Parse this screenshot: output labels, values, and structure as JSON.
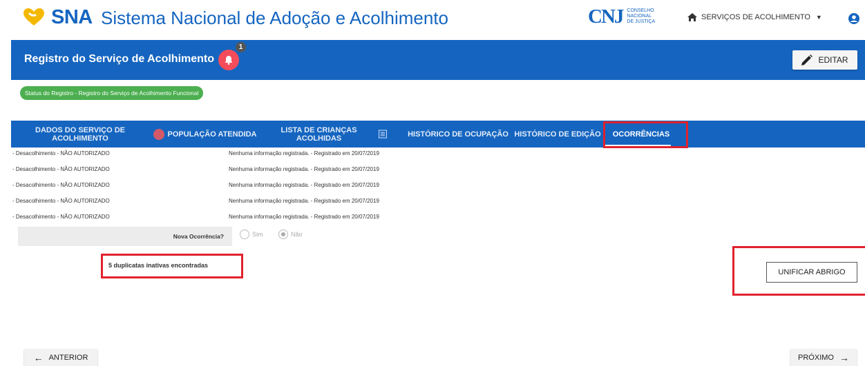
{
  "topbar": {
    "brand": "SNA",
    "app_title": "Sistema Nacional de Adoção e Acolhimento",
    "cnj_logo": "CNJ",
    "cnj_text_1": "CONSELHO",
    "cnj_text_2": "NACIONAL",
    "cnj_text_3": "DE JUSTIÇA",
    "nav_label": "SERVIÇOS DE ACOLHIMENTO",
    "nav_icon": "home-icon",
    "user_icon": "user-icon"
  },
  "header": {
    "title": "Registro do Serviço de Acolhimento",
    "notification_count": "1",
    "edit_label": "EDITAR"
  },
  "status": {
    "label": "Status do Registro - Registro do Serviço de Acolhimento Funcional"
  },
  "tabs": [
    {
      "label": "DADOS DO SERVIÇO DE ACOLHIMENTO"
    },
    {
      "label": "POPULAÇÃO ATENDIDA"
    },
    {
      "label": "LISTA DE CRIANÇAS ACOLHIDAS"
    },
    {
      "label": "HISTÓRICO DE OCUPAÇÃO"
    },
    {
      "label": "HISTÓRICO DE EDIÇÃO"
    },
    {
      "label": "OCORRÊNCIAS"
    }
  ],
  "occurrences": [
    {
      "type": "- Desacolhimento - NÃO AUTORIZADO",
      "desc": "Nenhuma informação registrada. - Registrado em 20/07/2019"
    },
    {
      "type": "- Desacolhimento - NÃO AUTORIZADO",
      "desc": "Nenhuma informação registrada. - Registrado em 20/07/2019"
    },
    {
      "type": "- Desacolhimento - NÃO AUTORIZADO",
      "desc": "Nenhuma informação registrada. - Registrado em 20/07/2019"
    },
    {
      "type": "- Desacolhimento - NÃO AUTORIZADO",
      "desc": "Nenhuma informação registrada. - Registrado em 20/07/2019"
    },
    {
      "type": "- Desacolhimento - NÃO AUTORIZADO",
      "desc": "Nenhuma informação registrada. - Registrado em 20/07/2019"
    }
  ],
  "new_occurrence": {
    "label": "Nova Ocorrência?",
    "option_yes": "Sim",
    "option_no": "Não",
    "selected": "Não"
  },
  "duplicates": {
    "label": "5 duplicatas inativas encontradas"
  },
  "actions": {
    "unify_label": "UNIFICAR ABRIGO",
    "prev_label": "ANTERIOR",
    "next_label": "PRÓXIMO"
  },
  "colors": {
    "primary": "#1565c0",
    "alert": "#f44c5b",
    "status": "#4caf50",
    "highlight": "#e0222d"
  }
}
